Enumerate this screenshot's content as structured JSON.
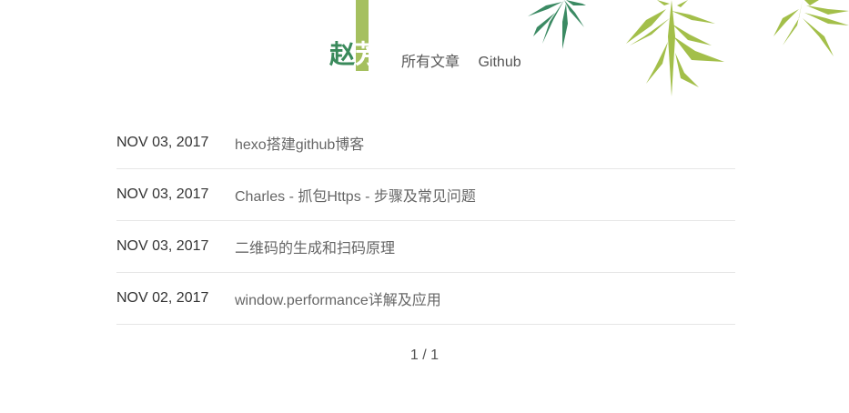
{
  "header": {
    "logo_char_1": "赵",
    "logo_char_2": "芳",
    "nav": [
      {
        "label": "所有文章"
      },
      {
        "label": "Github"
      }
    ]
  },
  "posts": [
    {
      "date": "NOV 03, 2017",
      "title": "hexo搭建github博客"
    },
    {
      "date": "NOV 03, 2017",
      "title": "Charles - 抓包Https - 步骤及常见问题"
    },
    {
      "date": "NOV 03, 2017",
      "title": "二维码的生成和扫码原理"
    },
    {
      "date": "NOV 02, 2017",
      "title": "window.performance详解及应用"
    }
  ],
  "pagination": {
    "text": "1 / 1"
  },
  "colors": {
    "accent_dark": "#3a8a5b",
    "accent_light": "#a5c05f"
  }
}
